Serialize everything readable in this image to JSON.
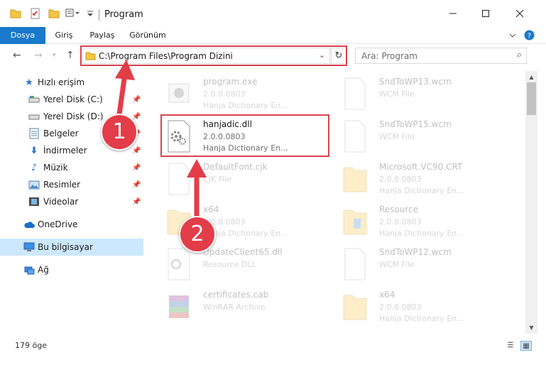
{
  "window": {
    "title": "Program",
    "min_icon": "minimize-icon",
    "max_icon": "maximize-icon",
    "close_icon": "close-icon"
  },
  "ribbon": {
    "tabs": [
      "Dosya",
      "Giriş",
      "Paylaş",
      "Görünüm"
    ],
    "file_tab_color": "#1979ca",
    "help_icon": "help-icon"
  },
  "address": {
    "path": "C:\\Program Files\\Program Dizini",
    "refresh_icon": "refresh-icon"
  },
  "search": {
    "placeholder": "Ara: Program"
  },
  "sidebar": {
    "items": [
      {
        "label": "Hızlı erişim",
        "icon": "star-icon",
        "pinned": false
      },
      {
        "label": "Yerel Disk (C:)",
        "icon": "drive-icon",
        "pinned": true
      },
      {
        "label": "Yerel Disk (D:)",
        "icon": "drive-icon",
        "pinned": true
      },
      {
        "label": "Belgeler",
        "icon": "documents-icon",
        "pinned": true
      },
      {
        "label": "İndirmeler",
        "icon": "download-icon",
        "pinned": true
      },
      {
        "label": "Müzik",
        "icon": "music-icon",
        "pinned": true
      },
      {
        "label": "Resimler",
        "icon": "pictures-icon",
        "pinned": true
      },
      {
        "label": "Videolar",
        "icon": "videos-icon",
        "pinned": true
      },
      {
        "label": "OneDrive",
        "icon": "cloud-icon",
        "pinned": false
      },
      {
        "label": "Bu bilgisayar",
        "icon": "computer-icon",
        "pinned": false,
        "selected": true
      },
      {
        "label": "Ağ",
        "icon": "network-icon",
        "pinned": false
      }
    ]
  },
  "files": [
    {
      "name": "program.exe",
      "line2": "2.0.0.0803",
      "line3": "Hanja Dictionary En...",
      "icon": "exe-icon",
      "faded": true
    },
    {
      "name": "SndToWP13.wcm",
      "line2": "WCM File",
      "line3": "",
      "icon": "file-icon",
      "faded": true
    },
    {
      "name": "hanjadic.dll",
      "line2": "2.0.0.0803",
      "line3": "Hanja Dictionary En...",
      "icon": "dll-gear-icon",
      "faded": false,
      "highlighted": true
    },
    {
      "name": "SndToWP15.wcm",
      "line2": "WCM File",
      "line3": "",
      "icon": "file-icon",
      "faded": true
    },
    {
      "name": "DefaultFont.cjk",
      "line2": "CJK File",
      "line3": "",
      "icon": "file-icon",
      "faded": true
    },
    {
      "name": "Microsoft.VC90.CRT",
      "line2": "2.0.0.0803",
      "line3": "Hanja Dictionary En...",
      "icon": "folder-icon",
      "faded": true
    },
    {
      "name": "x64",
      "line2": "2.0.0.0803",
      "line3": "Hanja Dictionary En...",
      "icon": "folder-icon",
      "faded": true
    },
    {
      "name": "Resource",
      "line2": "2.0.0.0803",
      "line3": "Hanja Dictionary En...",
      "icon": "folder-icon",
      "faded": true
    },
    {
      "name": "UpdateClient65.dll",
      "line2": "Resource DLL",
      "line3": "",
      "icon": "dll-gear-icon",
      "faded": true
    },
    {
      "name": "SndToWP12.wcm",
      "line2": "WCM File",
      "line3": "",
      "icon": "file-icon",
      "faded": true
    },
    {
      "name": "certificates.cab",
      "line2": "WinRAR Archive",
      "line3": "",
      "icon": "winrar-icon",
      "faded": true
    },
    {
      "name": "x64",
      "line2": "2.0.0.0803",
      "line3": "Hanja Dictionary En...",
      "icon": "folder-icon",
      "faded": true
    }
  ],
  "status": {
    "count": "179 öge"
  },
  "annotations": {
    "step1": "1",
    "step2": "2",
    "color": "#e33d4a"
  }
}
